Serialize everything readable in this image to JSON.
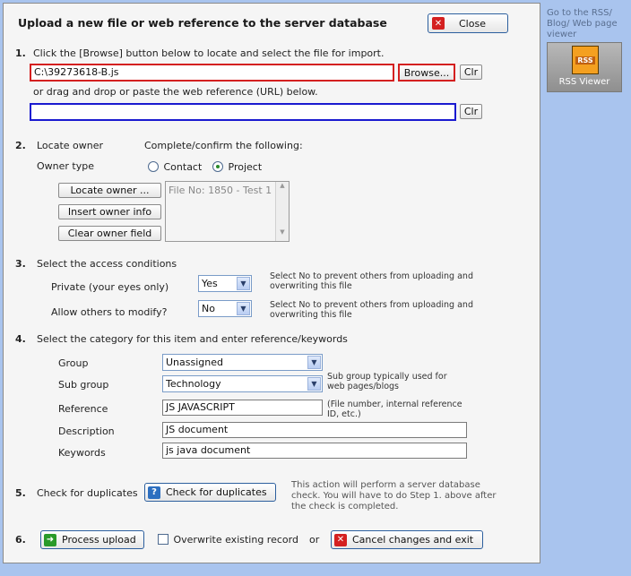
{
  "dialog": {
    "title": "Upload a new file or web reference to the server database",
    "close_label": "Close"
  },
  "step1": {
    "number": "1.",
    "instruction": "Click the [Browse] button below to locate and select the file for import.",
    "file_value": "C:\\39273618-B.js",
    "browse_label": "Browse...",
    "clear_label": "Clr",
    "drag_text": "or drag and drop or paste the web reference (URL) below.",
    "url_value": "",
    "clear_label2": "Clr"
  },
  "step2": {
    "number": "2.",
    "heading": "Locate owner",
    "confirm_text": "Complete/confirm the following:",
    "owner_type_label": "Owner type",
    "radio_contact": "Contact",
    "radio_project": "Project",
    "selected": "Project",
    "locate_owner_label": "Locate owner ...",
    "insert_owner_label": "Insert owner info",
    "clear_owner_label": "Clear owner field",
    "owner_field_text": "File No: 1850 - Test 1"
  },
  "step3": {
    "number": "3.",
    "heading": "Select the access conditions",
    "private_label": "Private (your eyes only)",
    "private_value": "Yes",
    "private_note": "Select No to prevent others from uploading and overwriting this file",
    "modify_label": "Allow others to modify?",
    "modify_value": "No",
    "modify_note": "Select No to prevent others from uploading and overwriting this file"
  },
  "step4": {
    "number": "4.",
    "heading": "Select the category for this item and enter reference/keywords",
    "group_label": "Group",
    "group_value": "Unassigned",
    "subgroup_label": "Sub group",
    "subgroup_value": "Technology",
    "subgroup_note": "Sub group typically used for web pages/blogs",
    "reference_label": "Reference",
    "reference_value": "JS JAVASCRIPT",
    "reference_note": "(File number, internal reference ID, etc.)",
    "description_label": "Description",
    "description_value": "JS document",
    "keywords_label": "Keywords",
    "keywords_value": "js java document"
  },
  "step5": {
    "number": "5.",
    "heading": "Check for duplicates",
    "button_label": "Check for duplicates",
    "note": "This action will perform a server database check. You will have to do Step 1. above after the check is completed."
  },
  "step6": {
    "number": "6.",
    "process_label": "Process upload",
    "overwrite_label": "Overwrite existing record",
    "or_text": "or",
    "cancel_label": "Cancel changes and exit"
  },
  "sidebar": {
    "rss_text": "Go to the RSS/ Blog/ Web page viewer",
    "rss_badge": "RSS",
    "rss_button_label": "RSS Viewer"
  },
  "colors": {
    "background": "#a9c4ee",
    "red_border": "#d42020",
    "blue_border": "#1a1ad0"
  }
}
